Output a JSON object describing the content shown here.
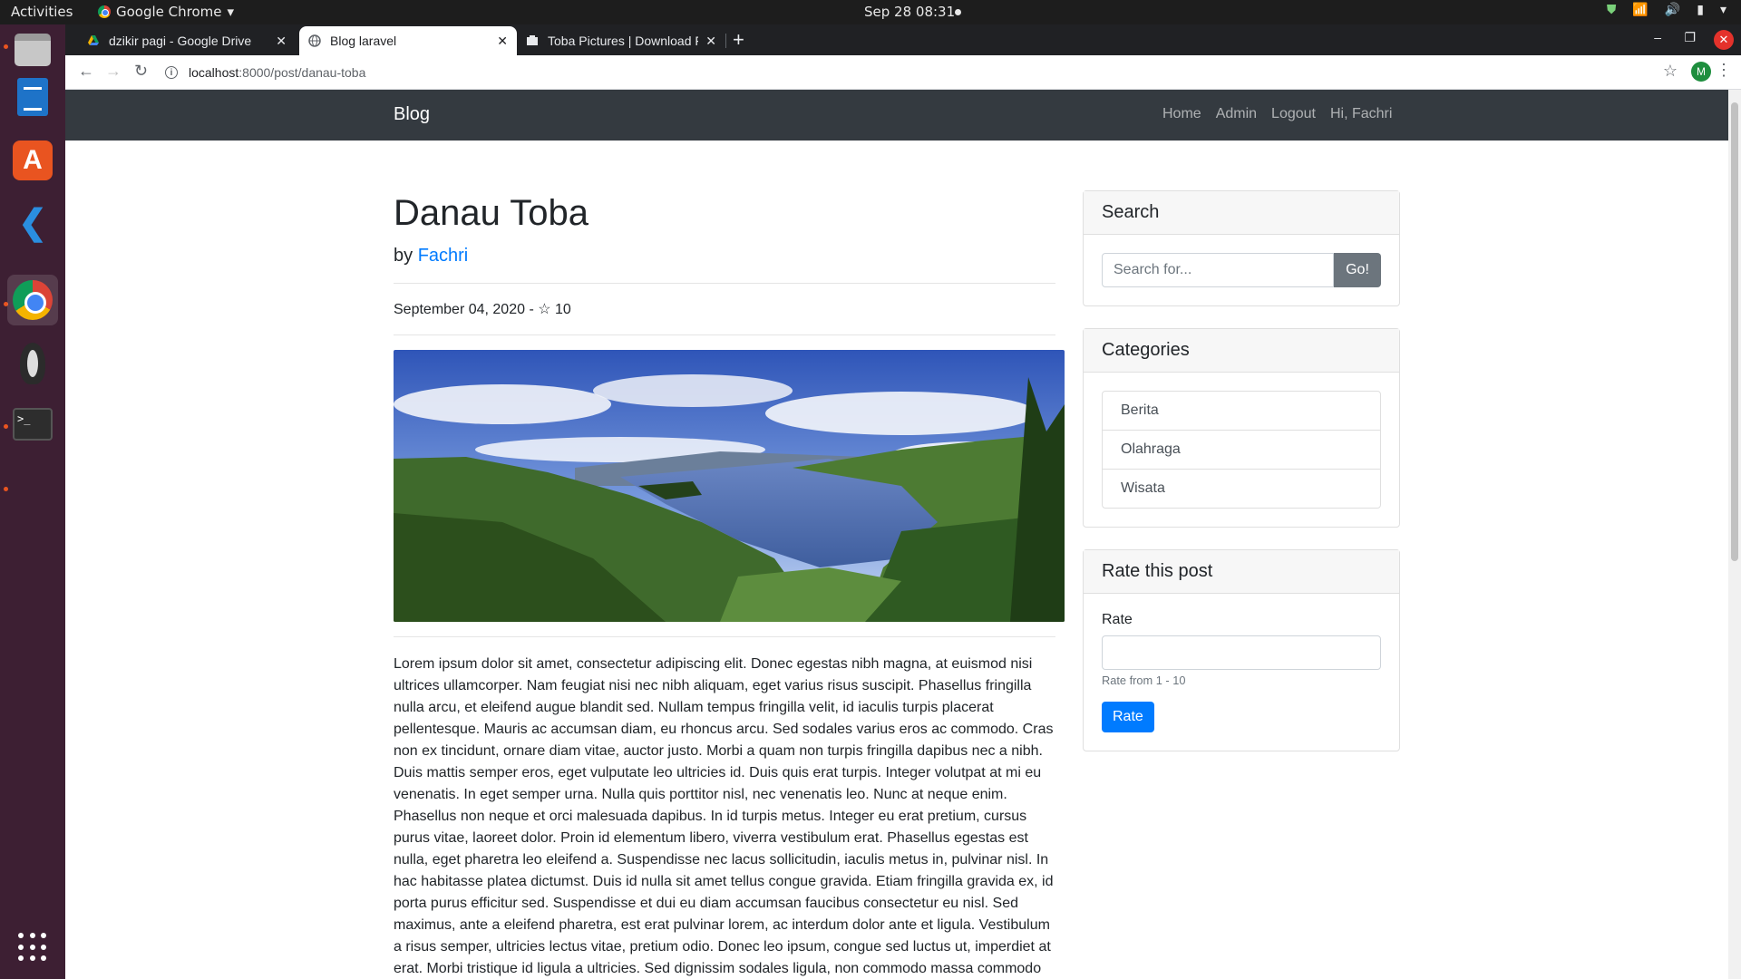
{
  "os": {
    "activities": "Activities",
    "app_name": "Google Chrome",
    "clock": "Sep 28  08:31"
  },
  "dock": {
    "items": [
      "files",
      "libreoffice-writer",
      "ubuntu-software",
      "vscode",
      "chrome",
      "penguin-app",
      "terminal"
    ]
  },
  "browser": {
    "tabs": [
      {
        "title": "dzikir pagi - Google Drive",
        "active": false
      },
      {
        "title": "Blog laravel",
        "active": true
      },
      {
        "title": "Toba Pictures | Download Free Images",
        "active": false
      }
    ],
    "url_host": "localhost",
    "url_path": ":8000/post/danau-toba",
    "profile_initial": "M"
  },
  "site": {
    "brand": "Blog",
    "nav": [
      "Home",
      "Admin",
      "Logout",
      "Hi, Fachri"
    ]
  },
  "post": {
    "title": "Danau Toba",
    "by_prefix": "by ",
    "author": "Fachri",
    "date": "September 04, 2020",
    "rating_sep": " - ",
    "rating_star": "☆",
    "rating": "10",
    "body": "Lorem ipsum dolor sit amet, consectetur adipiscing elit. Donec egestas nibh magna, at euismod nisi ultrices ullamcorper. Nam feugiat nisi nec nibh aliquam, eget varius risus suscipit. Phasellus fringilla nulla arcu, et eleifend augue blandit sed. Nullam tempus fringilla velit, id iaculis turpis placerat pellentesque. Mauris ac accumsan diam, eu rhoncus arcu. Sed sodales varius eros ac commodo. Cras non ex tincidunt, ornare diam vitae, auctor justo. Morbi a quam non turpis fringilla dapibus nec a nibh. Duis mattis semper eros, eget vulputate leo ultricies id. Duis quis erat turpis. Integer volutpat at mi eu venenatis. In eget semper urna. Nulla quis porttitor nisl, nec venenatis leo. Nunc at neque enim. Phasellus non neque et orci malesuada dapibus. In id turpis metus. Integer eu erat pretium, cursus purus vitae, laoreet dolor. Proin id elementum libero, viverra vestibulum erat. Phasellus egestas est nulla, eget pharetra leo eleifend a. Suspendisse nec lacus sollicitudin, iaculis metus in, pulvinar nisl. In hac habitasse platea dictumst. Duis id nulla sit amet tellus congue gravida. Etiam fringilla gravida ex, id porta purus efficitur sed. Suspendisse et dui eu diam accumsan faucibus consectetur eu nisl. Sed maximus, ante a eleifend pharetra, est erat pulvinar lorem, ac interdum dolor ante et ligula. Vestibulum a risus semper, ultricies lectus vitae, pretium odio. Donec leo ipsum, congue sed luctus ut, imperdiet at erat. Morbi tristique id ligula a ultricies. Sed dignissim sodales ligula, non commodo massa commodo"
  },
  "sidebar": {
    "search": {
      "header": "Search",
      "placeholder": "Search for...",
      "button": "Go!"
    },
    "categories": {
      "header": "Categories",
      "items": [
        "Berita",
        "Olahraga",
        "Wisata"
      ]
    },
    "rate": {
      "header": "Rate this post",
      "label": "Rate",
      "help": "Rate from 1 - 10",
      "button": "Rate"
    }
  },
  "colors": {
    "navbar": "#343a40",
    "primary": "#007bff",
    "secondary": "#6c757d",
    "dock": "#3d1f33",
    "ubuntu_orange": "#e95420"
  }
}
